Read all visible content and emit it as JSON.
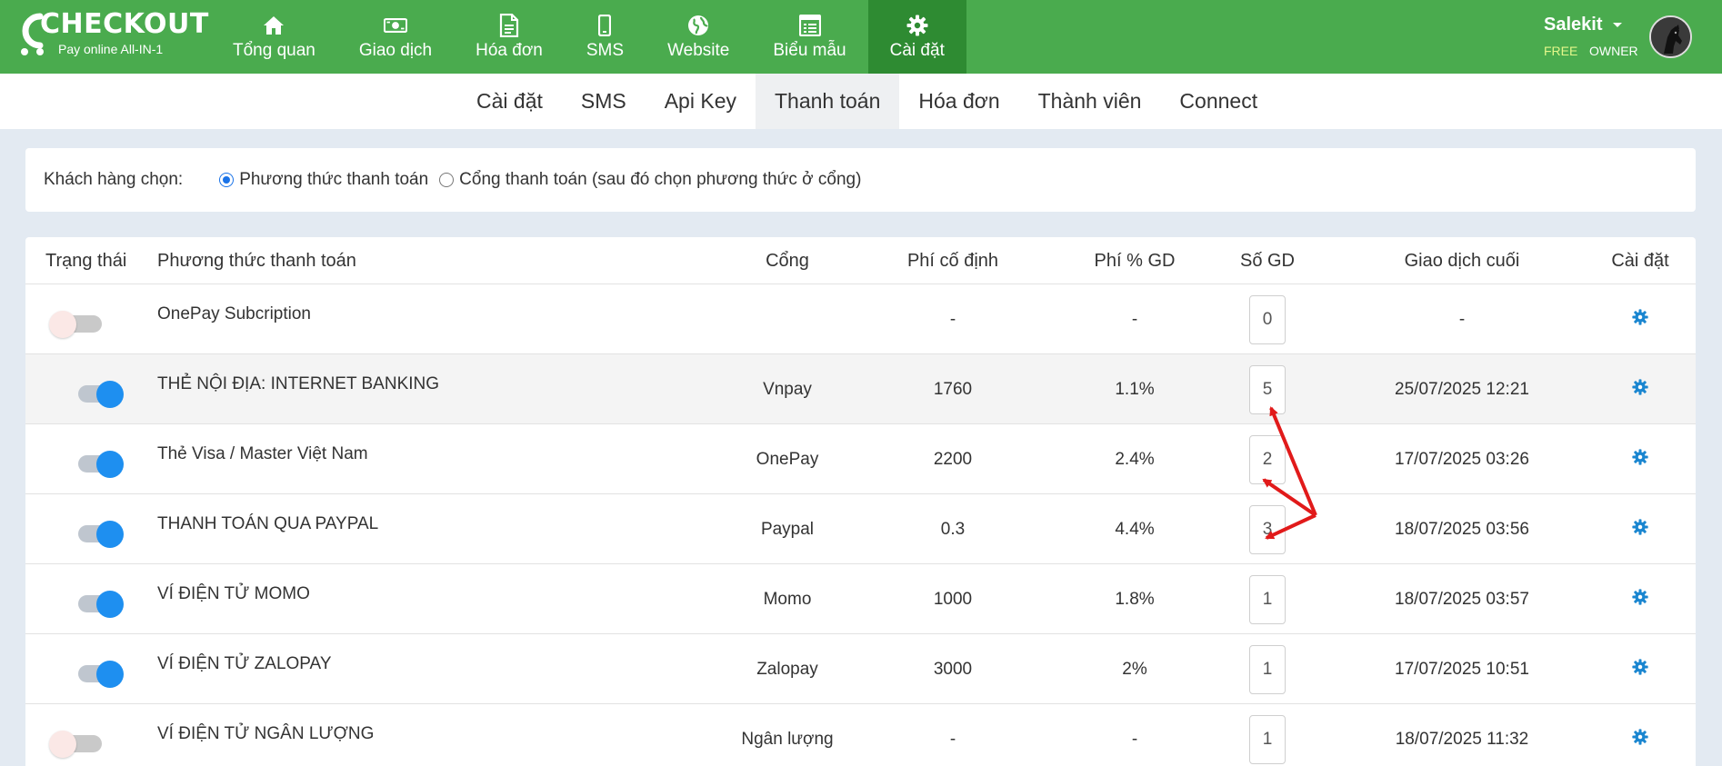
{
  "brand": {
    "logo_text": "CHECKOUT",
    "tagline": "Pay online All-IN-1"
  },
  "nav": [
    {
      "label": "Tổng quan",
      "icon": "home-icon"
    },
    {
      "label": "Giao dịch",
      "icon": "money-icon"
    },
    {
      "label": "Hóa đơn",
      "icon": "document-icon"
    },
    {
      "label": "SMS",
      "icon": "mobile-icon"
    },
    {
      "label": "Website",
      "icon": "globe-icon"
    },
    {
      "label": "Biểu mẫu",
      "icon": "form-icon"
    },
    {
      "label": "Cài đặt",
      "icon": "gear-icon",
      "active": true
    }
  ],
  "user": {
    "name": "Salekit",
    "plan": "FREE",
    "role": "OWNER"
  },
  "subnav": [
    {
      "label": "Cài đặt"
    },
    {
      "label": "SMS"
    },
    {
      "label": "Api Key"
    },
    {
      "label": "Thanh toán",
      "active": true
    },
    {
      "label": "Hóa đơn"
    },
    {
      "label": "Thành viên"
    },
    {
      "label": "Connect"
    }
  ],
  "customer_choice": {
    "label": "Khách hàng chọn:",
    "options": [
      {
        "label": "Phương thức thanh toán",
        "checked": true
      },
      {
        "label": "Cổng thanh toán (sau đó chọn phương thức ở cổng)",
        "checked": false
      }
    ]
  },
  "table": {
    "headers": {
      "status": "Trạng thái",
      "method": "Phương thức thanh toán",
      "gateway": "Cổng",
      "fixed_fee": "Phí cố định",
      "percent_fee": "Phí % GD",
      "count": "Số GD",
      "last": "Giao dịch cuối",
      "settings": "Cài đặt"
    },
    "rows": [
      {
        "enabled": false,
        "method": "OnePay Subcription",
        "gateway": "",
        "fixed_fee": "-",
        "percent_fee": "-",
        "count": "0",
        "last": "-"
      },
      {
        "enabled": true,
        "method": "THẺ NỘI ĐỊA: INTERNET BANKING",
        "gateway": "Vnpay",
        "fixed_fee": "1760",
        "percent_fee": "1.1%",
        "count": "5",
        "last": "25/07/2025 12:21"
      },
      {
        "enabled": true,
        "method": "Thẻ Visa / Master Việt Nam",
        "gateway": "OnePay",
        "fixed_fee": "2200",
        "percent_fee": "2.4%",
        "count": "2",
        "last": "17/07/2025 03:26"
      },
      {
        "enabled": true,
        "method": "THANH TOÁN QUA PAYPAL",
        "gateway": "Paypal",
        "fixed_fee": "0.3",
        "percent_fee": "4.4%",
        "count": "3",
        "last": "18/07/2025 03:56"
      },
      {
        "enabled": true,
        "method": "VÍ ĐIỆN TỬ MOMO",
        "gateway": "Momo",
        "fixed_fee": "1000",
        "percent_fee": "1.8%",
        "count": "1",
        "last": "18/07/2025 03:57"
      },
      {
        "enabled": true,
        "method": "VÍ ĐIỆN TỬ ZALOPAY",
        "gateway": "Zalopay",
        "fixed_fee": "3000",
        "percent_fee": "2%",
        "count": "1",
        "last": "17/07/2025 10:51"
      },
      {
        "enabled": false,
        "method": "VÍ ĐIỆN TỬ NGÂN LƯỢNG",
        "gateway": "Ngân lượng",
        "fixed_fee": "-",
        "percent_fee": "-",
        "count": "1",
        "last": "18/07/2025 11:32"
      }
    ]
  },
  "colors": {
    "brand_green": "#4aab4e",
    "active_green": "#2e8b32",
    "toggle_on": "#1e8ff0",
    "gear_blue": "#1a86d0",
    "annotation_red": "#e11a1a"
  }
}
